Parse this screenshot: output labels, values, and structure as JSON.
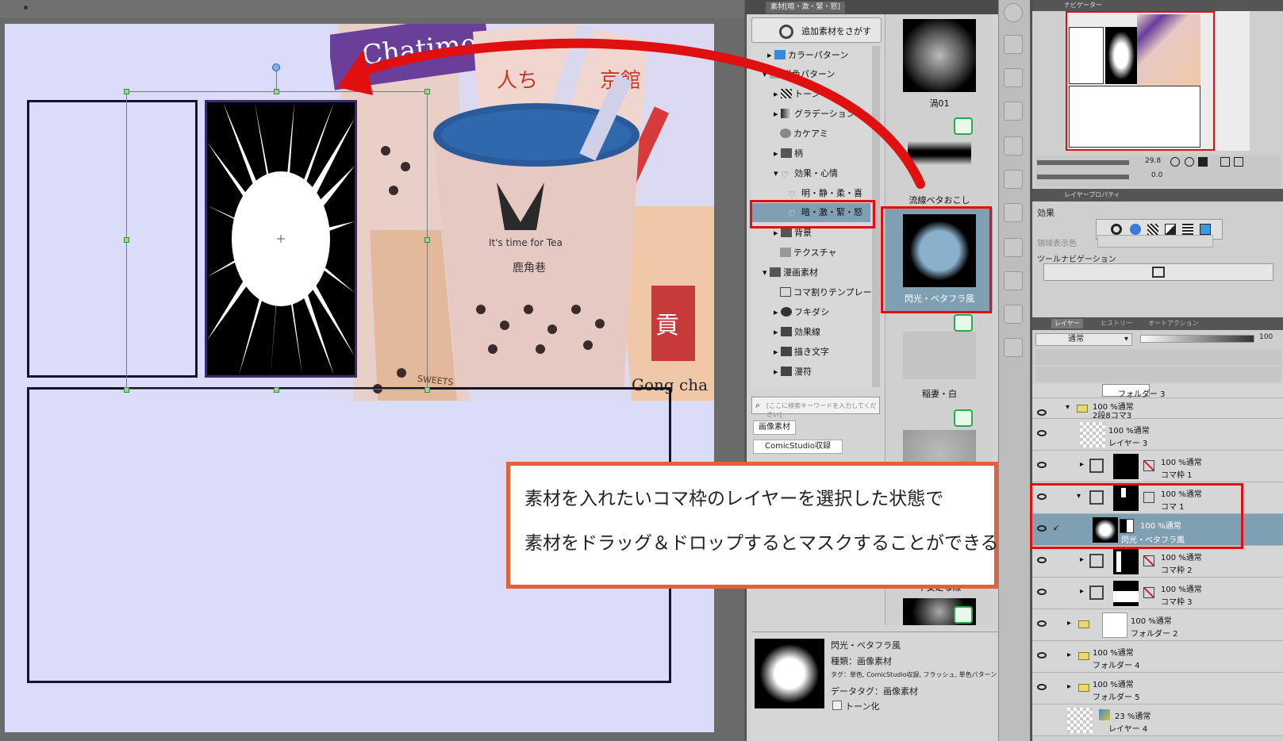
{
  "material_panel": {
    "tab_title": "素材[暗・激・緊・怒]",
    "find_more_button": "追加素材をさがす",
    "tree": [
      "カラーパターン",
      "単色パターン",
      "トーン",
      "グラデーション",
      "カケアミ",
      "柄",
      "効果・心情",
      "明・静・柔・喜",
      "暗・激・緊・怒",
      "背景",
      "テクスチャ",
      "漫画素材",
      "コマ割りテンプレート",
      "フキダシ",
      "効果線",
      "描き文字",
      "漫符"
    ],
    "search_placeholder": "[ここに検索キーワードを入力してください]",
    "tags": [
      "画像素材",
      "ComicStudio収録"
    ],
    "thumbnails": [
      "渦01",
      "流線ベタおこし",
      "閃光・ベタフラ風",
      "稲妻・白",
      "不安定な線"
    ],
    "detail": {
      "name": "閃光・ベタフラ風",
      "type": "種類：画像素材",
      "tags": "タグ：単色, ComicStudio収録, フラッシュ, 単色パターン, 効果線",
      "data_tag": "データタグ：画像素材",
      "tone_checkbox": "トーン化"
    }
  },
  "navigator": {
    "title": "ナビゲーター",
    "zoom": "29.8",
    "rotate": "0.0"
  },
  "layer_property": {
    "title": "レイヤープロパティ",
    "effect_label": "効果",
    "area_color_label": "領域表示色",
    "tool_nav_label": "ツールナビゲーション"
  },
  "layer_panel": {
    "tabs": [
      "レイヤー",
      "ヒストリー",
      "オートアクション"
    ],
    "blend_mode": "通常",
    "opacity": "100",
    "layers": [
      {
        "mode": "",
        "name": "フォルダー 3"
      },
      {
        "mode": "100 %通常",
        "name": "2段8コマ3"
      },
      {
        "mode": "100 %通常",
        "name": "レイヤー 3"
      },
      {
        "mode": "100 %通常",
        "name": "コマ枠 1"
      },
      {
        "mode": "100 %通常",
        "name": "コマ 1"
      },
      {
        "mode": "100 %通常",
        "name": "閃光・ベタフラ風"
      },
      {
        "mode": "100 %通常",
        "name": "コマ枠 2"
      },
      {
        "mode": "100 %通常",
        "name": "コマ枠 3"
      },
      {
        "mode": "100 %通常",
        "name": "フォルダー 2"
      },
      {
        "mode": "100 %通常",
        "name": "フォルダー 4"
      },
      {
        "mode": "100 %通常",
        "name": "フォルダー 5"
      },
      {
        "mode": "23 %通常",
        "name": "レイヤー 4"
      }
    ]
  },
  "callout": {
    "line1": "素材を入れたいコマ枠のレイヤーを選択した状態で",
    "line2": "素材をドラッグ＆ドロップするとマスクすることができる"
  },
  "illustration": {
    "brand_text": "Chatime",
    "gongcha_text": "Gong cha",
    "sweets_text": "SWEETS TAPIOCA"
  },
  "colors": {
    "highlight": "#e01010",
    "callout_border": "#e3603a",
    "paper": "#dbdbfa",
    "selected_row": "#7f9fb3"
  }
}
